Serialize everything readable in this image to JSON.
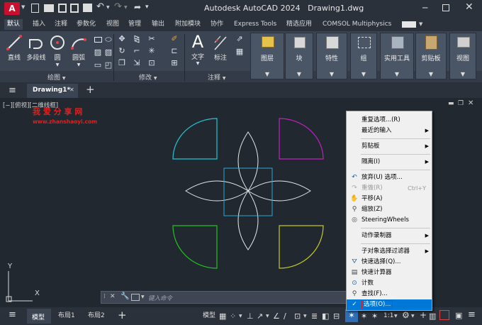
{
  "title": {
    "app": "Autodesk AutoCAD 2024",
    "file": "Drawing1.dwg",
    "logo": "A",
    "colors": {
      "logo": "#c8102e"
    }
  },
  "ribbon_tabs": [
    "默认",
    "插入",
    "注释",
    "参数化",
    "视图",
    "管理",
    "输出",
    "附加模块",
    "协作",
    "Express Tools",
    "精选应用",
    "COMSOL Multiphysics"
  ],
  "draw_panel": {
    "tools": [
      "直线",
      "多段线",
      "圆",
      "圆弧"
    ],
    "title": "绘图"
  },
  "modify_panel": {
    "title": "修改"
  },
  "annotate_panel": {
    "tools": [
      "文字",
      "标注"
    ],
    "title": "注释"
  },
  "big_panels": [
    "图层",
    "块",
    "特性",
    "组",
    "实用工具",
    "剪贴板",
    "视图"
  ],
  "doc_tab": "Drawing1*",
  "viewport_label": "[−][俯视][二维线框]",
  "watermark": {
    "title": "我 爱 分 享 网",
    "url": "www.zhanshaoyi.com"
  },
  "ucs": {
    "y": "Y",
    "x": "X"
  },
  "command_placeholder": "键入命令",
  "context_menu": [
    {
      "label": "重复选项...(R)",
      "arrow": false
    },
    {
      "label": "最近的输入",
      "arrow": true
    },
    {
      "label": "剪贴板",
      "arrow": true
    },
    {
      "label": "隔离(I)",
      "arrow": true
    },
    {
      "label": "放弃(U) 选项...",
      "icon": "undo-icon"
    },
    {
      "label": "重做(R)",
      "shortcut": "Ctrl+Y",
      "disabled": true,
      "icon": "redo-icon"
    },
    {
      "label": "平移(A)",
      "icon": "pan-hand-icon"
    },
    {
      "label": "缩放(Z)",
      "icon": "zoom-icon"
    },
    {
      "label": "SteeringWheels",
      "icon": "steeringwheel-icon"
    },
    {
      "label": "动作录制器",
      "arrow": true
    },
    {
      "label": "子对象选择过滤器",
      "arrow": true
    },
    {
      "label": "快速选择(Q)...",
      "icon": "quick-select-icon"
    },
    {
      "label": "快速计算器",
      "icon": "calculator-icon"
    },
    {
      "label": "计数",
      "icon": "count-icon"
    },
    {
      "label": "查找(F)...",
      "icon": "find-icon"
    },
    {
      "label": "选项(O)...",
      "highlighted": true,
      "icon": "check-icon"
    }
  ],
  "layout_tabs": [
    "模型",
    "布局1",
    "布局2"
  ],
  "status": {
    "model": "模型",
    "scale": "1:1"
  },
  "accent_colors": {
    "cyan": "#22c5d5",
    "magenta": "#c020c0",
    "green": "#22c022",
    "yellow": "#c8c820",
    "white": "#e6e6e6",
    "selection": "#2aa7d6",
    "highlight": "#0078d7"
  }
}
